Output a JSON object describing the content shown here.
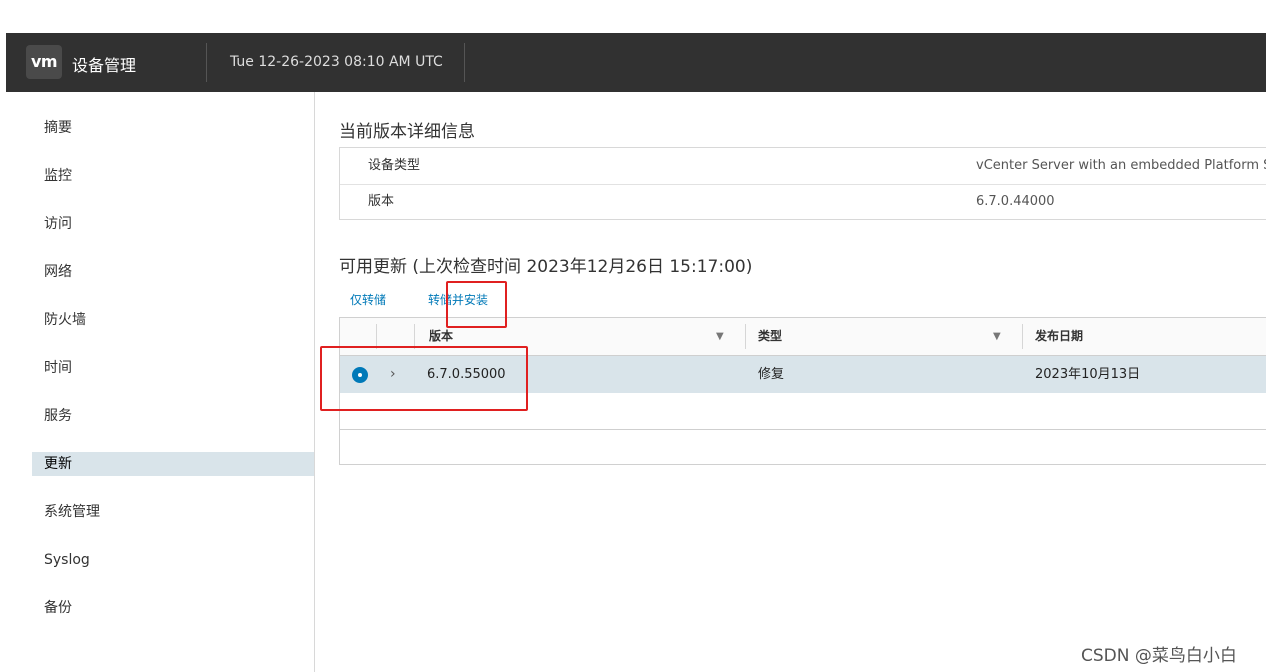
{
  "header": {
    "logo": "vm",
    "app_title": "设备管理",
    "datetime": "Tue 12-26-2023 08:10 AM UTC"
  },
  "sidebar": {
    "items": [
      {
        "label": "摘要"
      },
      {
        "label": "监控"
      },
      {
        "label": "访问"
      },
      {
        "label": "网络"
      },
      {
        "label": "防火墙"
      },
      {
        "label": "时间"
      },
      {
        "label": "服务"
      },
      {
        "label": "更新",
        "active": true
      },
      {
        "label": "系统管理"
      },
      {
        "label": "Syslog"
      },
      {
        "label": "备份"
      }
    ]
  },
  "main": {
    "current_version": {
      "title": "当前版本详细信息",
      "rows": [
        {
          "key": "设备类型",
          "value": "vCenter Server with an embedded Platform Se"
        },
        {
          "key": "版本",
          "value": "6.7.0.44000"
        }
      ]
    },
    "updates": {
      "title": "可用更新 (上次检查时间 2023年12月26日 15:17:00)",
      "actions": {
        "stage_only": "仅转储",
        "stage_install": "转储并安装"
      },
      "columns": [
        "版本",
        "类型",
        "发布日期"
      ],
      "filter_icon": "filter-icon",
      "rows": [
        {
          "version": "6.7.0.55000",
          "type": "修复",
          "release_date": "2023年10月13日",
          "selected": true
        }
      ]
    }
  },
  "watermark": "CSDN @菜鸟白小白",
  "colors": {
    "header_bg": "#313131",
    "accent": "#0079b8",
    "selected_row": "#d9e4ea",
    "highlight_box": "#e02020"
  }
}
